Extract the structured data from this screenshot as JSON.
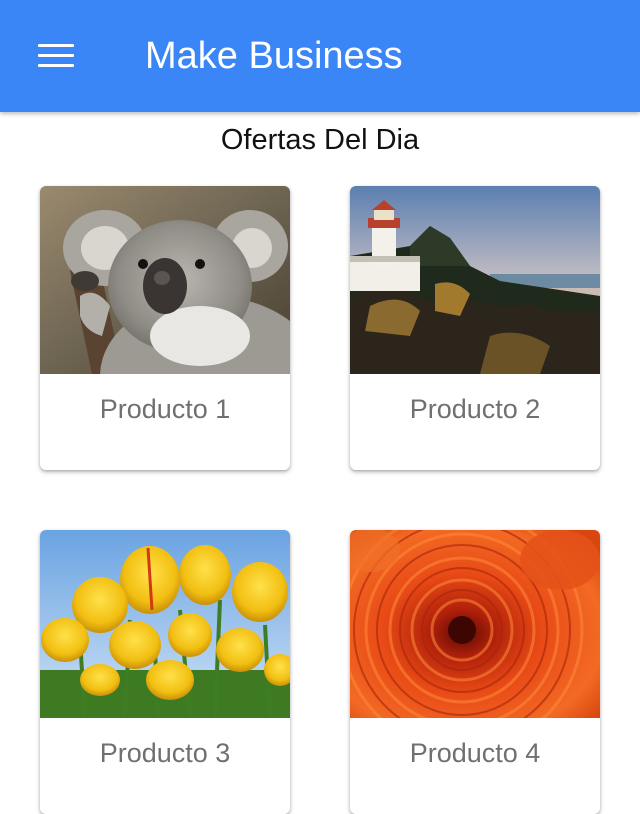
{
  "header": {
    "title": "Make Business",
    "menu_icon": "hamburger-menu-icon",
    "background": "#3b86f6"
  },
  "section": {
    "title": "Ofertas Del Dia"
  },
  "products": [
    {
      "label": "Producto 1",
      "image": "koala-photo"
    },
    {
      "label": "Producto 2",
      "image": "lighthouse-photo"
    },
    {
      "label": "Producto 3",
      "image": "tulips-photo"
    },
    {
      "label": "Producto 4",
      "image": "chrysanthemum-photo"
    }
  ]
}
